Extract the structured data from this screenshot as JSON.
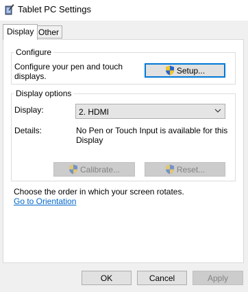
{
  "window": {
    "title": "Tablet PC Settings"
  },
  "tabs": [
    {
      "label": "Display",
      "active": true
    },
    {
      "label": "Other",
      "active": false
    }
  ],
  "configure": {
    "legend": "Configure",
    "description": "Configure your pen and touch displays.",
    "setup_button": "Setup..."
  },
  "display_options": {
    "legend": "Display options",
    "display_label": "Display:",
    "display_value": "2. HDMI",
    "details_label": "Details:",
    "details_text": "No Pen or Touch Input is available for this Display",
    "calibrate_button": "Calibrate...",
    "reset_button": "Reset..."
  },
  "orientation": {
    "text": "Choose the order in which your screen rotates.",
    "link": "Go to Orientation"
  },
  "footer": {
    "ok": "OK",
    "cancel": "Cancel",
    "apply": "Apply"
  },
  "colors": {
    "accent": "#0078d7",
    "link": "#0066cc",
    "shield_blue": "#2b63c5",
    "shield_yellow": "#f2c62d"
  },
  "icons": {
    "app": "tablet-pen-icon",
    "shield": "uac-shield-icon",
    "dropdown": "chevron-down-icon"
  }
}
